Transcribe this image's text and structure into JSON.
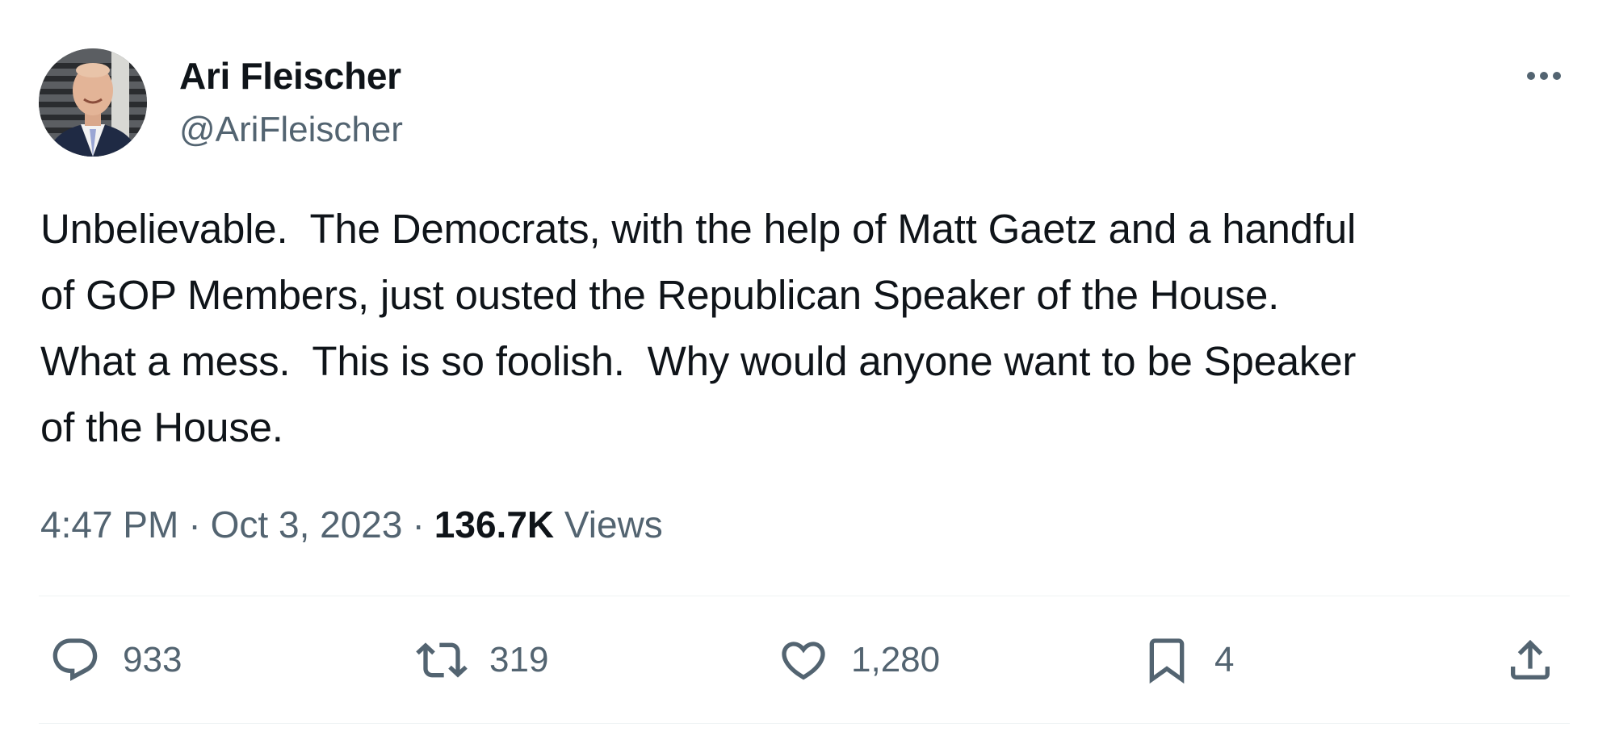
{
  "author": {
    "display_name": "Ari Fleischer",
    "handle": "@AriFleischer"
  },
  "tweet": {
    "text": "Unbelievable.  The Democrats, with the help of Matt Gaetz and a handful\nof GOP Members, just ousted the Republican Speaker of the House.\nWhat a mess.  This is so foolish.  Why would anyone want to be Speaker\nof the House.",
    "time": "4:47 PM",
    "date": "Oct 3, 2023",
    "separator": "·",
    "views_count": "136.7K",
    "views_label": "Views"
  },
  "actions": {
    "replies": "933",
    "reposts": "319",
    "likes": "1,280",
    "bookmarks": "4"
  },
  "icons": {
    "more": "more-horizontal-icon",
    "reply": "speech-bubble-icon",
    "repost": "repost-arrows-icon",
    "like": "heart-icon",
    "bookmark": "bookmark-icon",
    "share": "share-upload-icon"
  },
  "colors": {
    "text_primary": "#0f1419",
    "text_secondary": "#536471",
    "divider": "#eff3f4",
    "background": "#ffffff"
  }
}
